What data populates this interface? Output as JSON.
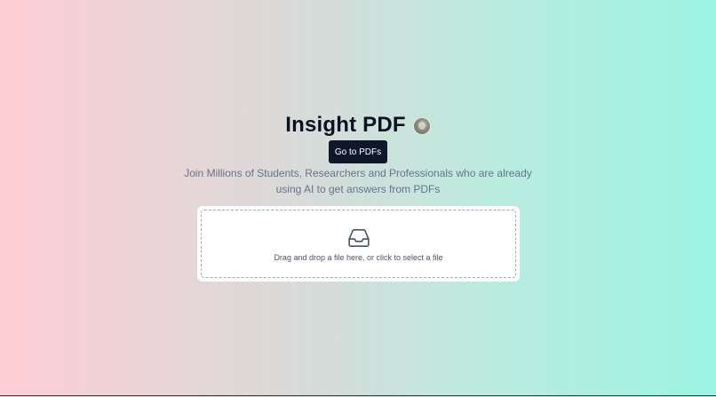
{
  "header": {
    "title": "Insight PDF",
    "avatar_icon": "user-avatar"
  },
  "cta": {
    "label": "Go to PDFs"
  },
  "tagline": {
    "text": "Join Millions of Students, Researchers and Professionals who are already using AI to get answers from PDFs"
  },
  "upload": {
    "icon": "inbox-icon",
    "prompt": "Drag and drop a file here, or click to select a file"
  },
  "colors": {
    "gradient_left": "#fdcdd4",
    "gradient_right": "#9cf4e4",
    "button_bg": "#0f172a",
    "title_text": "#0b1120",
    "subtitle_text": "#64748b"
  }
}
